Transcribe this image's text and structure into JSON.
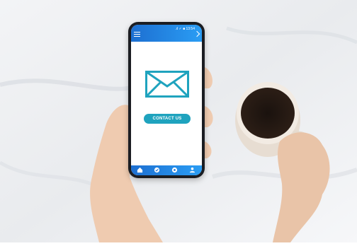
{
  "screen": {
    "status_text": ".ıl ✓ ■ 13:54",
    "cta_label": "CONTACT US",
    "accent_color": "#1fa3be",
    "bar_color": "#1d6fd1"
  },
  "icons": {
    "menu": "menu-icon",
    "chevron": "chevron-right-icon",
    "envelope": "envelope-icon",
    "home": "home-icon",
    "check": "check-icon",
    "compass": "compass-icon",
    "user": "user-icon"
  }
}
